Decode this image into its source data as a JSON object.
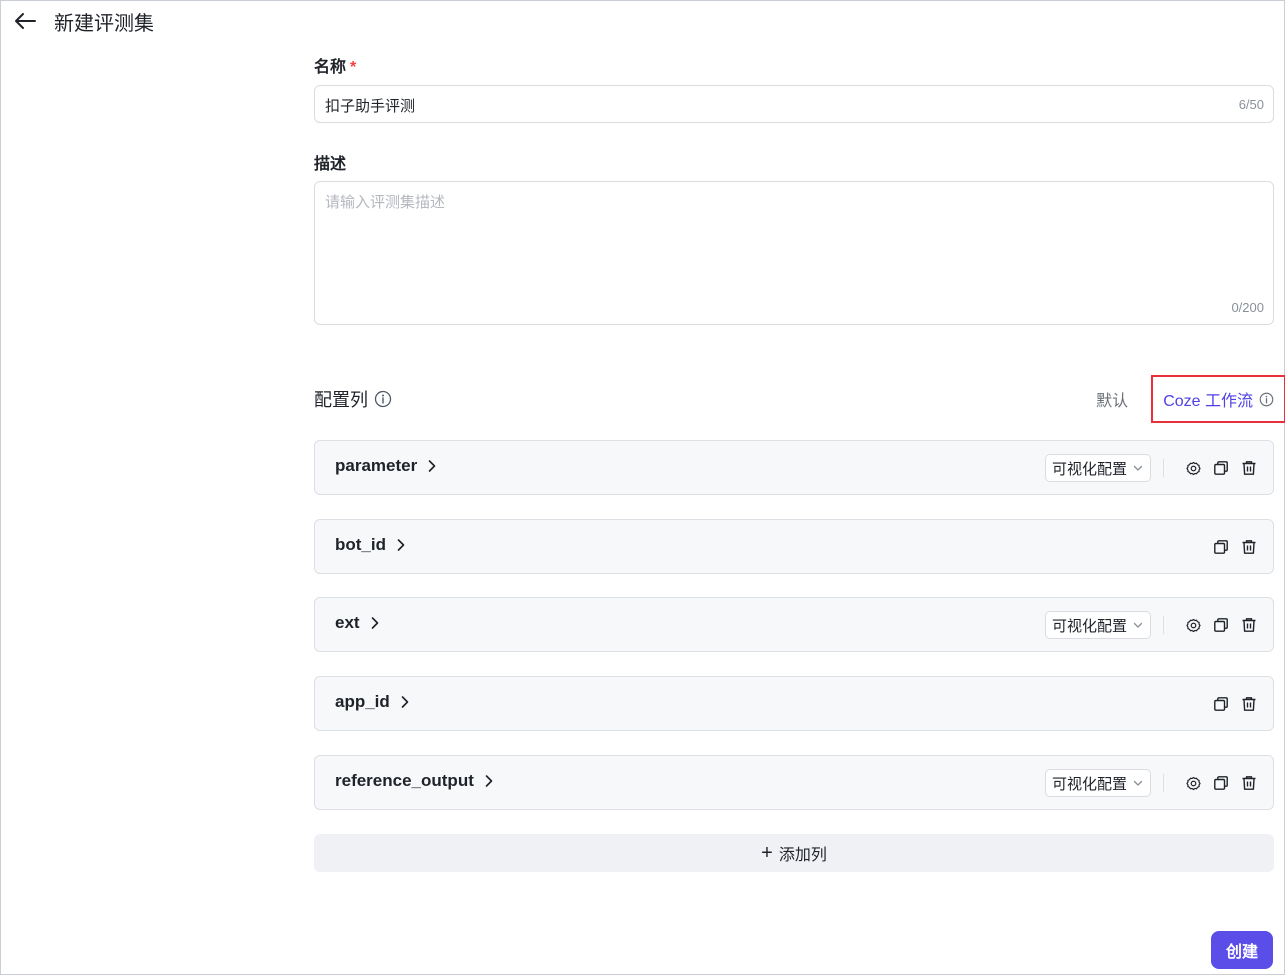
{
  "header": {
    "title": "新建评测集"
  },
  "form": {
    "name": {
      "label": "名称",
      "required_mark": "*",
      "value": "扣子助手评测",
      "counter": "6/50"
    },
    "description": {
      "label": "描述",
      "placeholder": "请输入评测集描述",
      "value": "",
      "counter": "0/200"
    }
  },
  "columns_section": {
    "title": "配置列",
    "modes": {
      "default_label": "默认",
      "coze_label": "Coze 工作流"
    },
    "rows": [
      {
        "name": "parameter",
        "select": "可视化配置"
      },
      {
        "name": "bot_id"
      },
      {
        "name": "ext",
        "select": "可视化配置"
      },
      {
        "name": "app_id"
      },
      {
        "name": "reference_output",
        "select": "可视化配置"
      }
    ],
    "add_label": "添加列",
    "add_symbol": "+"
  },
  "footer": {
    "create_label": "创建"
  },
  "colors": {
    "accent": "#5a4de8",
    "coze_link": "#4e40e5",
    "highlight_box": "#e8303a",
    "required": "#f53f3f"
  },
  "icons": {
    "back": "arrow-left-icon",
    "info": "info-circle-icon",
    "chevron": "chevron-right-icon",
    "caret": "chevron-down-icon",
    "settings": "gear-icon",
    "copy": "copy-icon",
    "delete": "trash-icon"
  }
}
